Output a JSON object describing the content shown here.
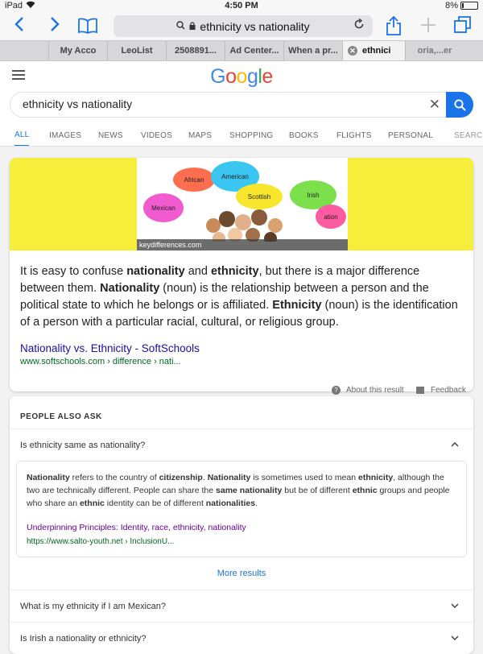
{
  "status": {
    "device": "iPad",
    "time": "4:50 PM",
    "battery": "8%"
  },
  "nav": {
    "url": "ethnicity vs nationality"
  },
  "tabs": [
    {
      "label": "My Acco"
    },
    {
      "label": "LeoList"
    },
    {
      "label": "2508891..."
    },
    {
      "label": "Ad Center..."
    },
    {
      "label": "When a pr..."
    },
    {
      "label": "ethnici"
    },
    {
      "label": "oria,...er"
    }
  ],
  "google": {
    "logo_letters": [
      "G",
      "o",
      "o",
      "g",
      "l",
      "e"
    ],
    "logo_colors": [
      "#4285F4",
      "#EA4335",
      "#FBBC05",
      "#4285F4",
      "#34A853",
      "#EA4335"
    ]
  },
  "search": {
    "query": "ethnicity vs nationality"
  },
  "search_tabs": [
    "ALL",
    "IMAGES",
    "NEWS",
    "VIDEOS",
    "MAPS",
    "SHOPPING",
    "BOOKS",
    "FLIGHTS",
    "PERSONAL",
    "SEARC"
  ],
  "featured": {
    "image_labels": [
      "African",
      "American",
      "Mexican",
      "Scottish",
      "Irish",
      "ation"
    ],
    "image_credit": "keydifferences.com",
    "snippet": {
      "p1": "It is easy to confuse ",
      "b1": "nationality",
      "p2": " and ",
      "b2": "ethnicity",
      "p3": ", but there is a major difference between them. ",
      "b3": "Nationality",
      "p4": " (noun) is the relationship between a person and the political state to which he belongs or is affiliated. ",
      "b4": "Ethnicity",
      "p5": " (noun) is the identification of a person with a particular racial, cultural, or religious group."
    },
    "source_title": "Nationality vs. Ethnicity - SoftSchools",
    "source_url": "www.softschools.com › difference › nati...",
    "about": "About this result",
    "feedback": "Feedback"
  },
  "paa": {
    "heading": "PEOPLE ALSO ASK",
    "q1": "Is ethnicity same as nationality?",
    "answer": {
      "b1": "Nationality",
      "t1": " refers to the country of ",
      "b2": "citizenship",
      "t2": ". ",
      "b3": "Nationality",
      "t3": " is sometimes used to mean ",
      "b4": "ethnicity",
      "t4": ", although the two are technically different. People can share the ",
      "b5": "same nationality",
      "t5": " but be of different ",
      "b6": "ethnic",
      "t6": " groups and people who share an ",
      "b7": "ethnic",
      "t7": " identity can be of different ",
      "b8": "nationalities",
      "t8": ".",
      "link": "Underpinning Principles: Identity, race, ethnicity, nationality",
      "url": "https://www.salto-youth.net › InclusionU..."
    },
    "more": "More results",
    "q2": "What is my ethnicity if I am Mexican?",
    "q3": "Is Irish a nationality or ethnicity?"
  }
}
